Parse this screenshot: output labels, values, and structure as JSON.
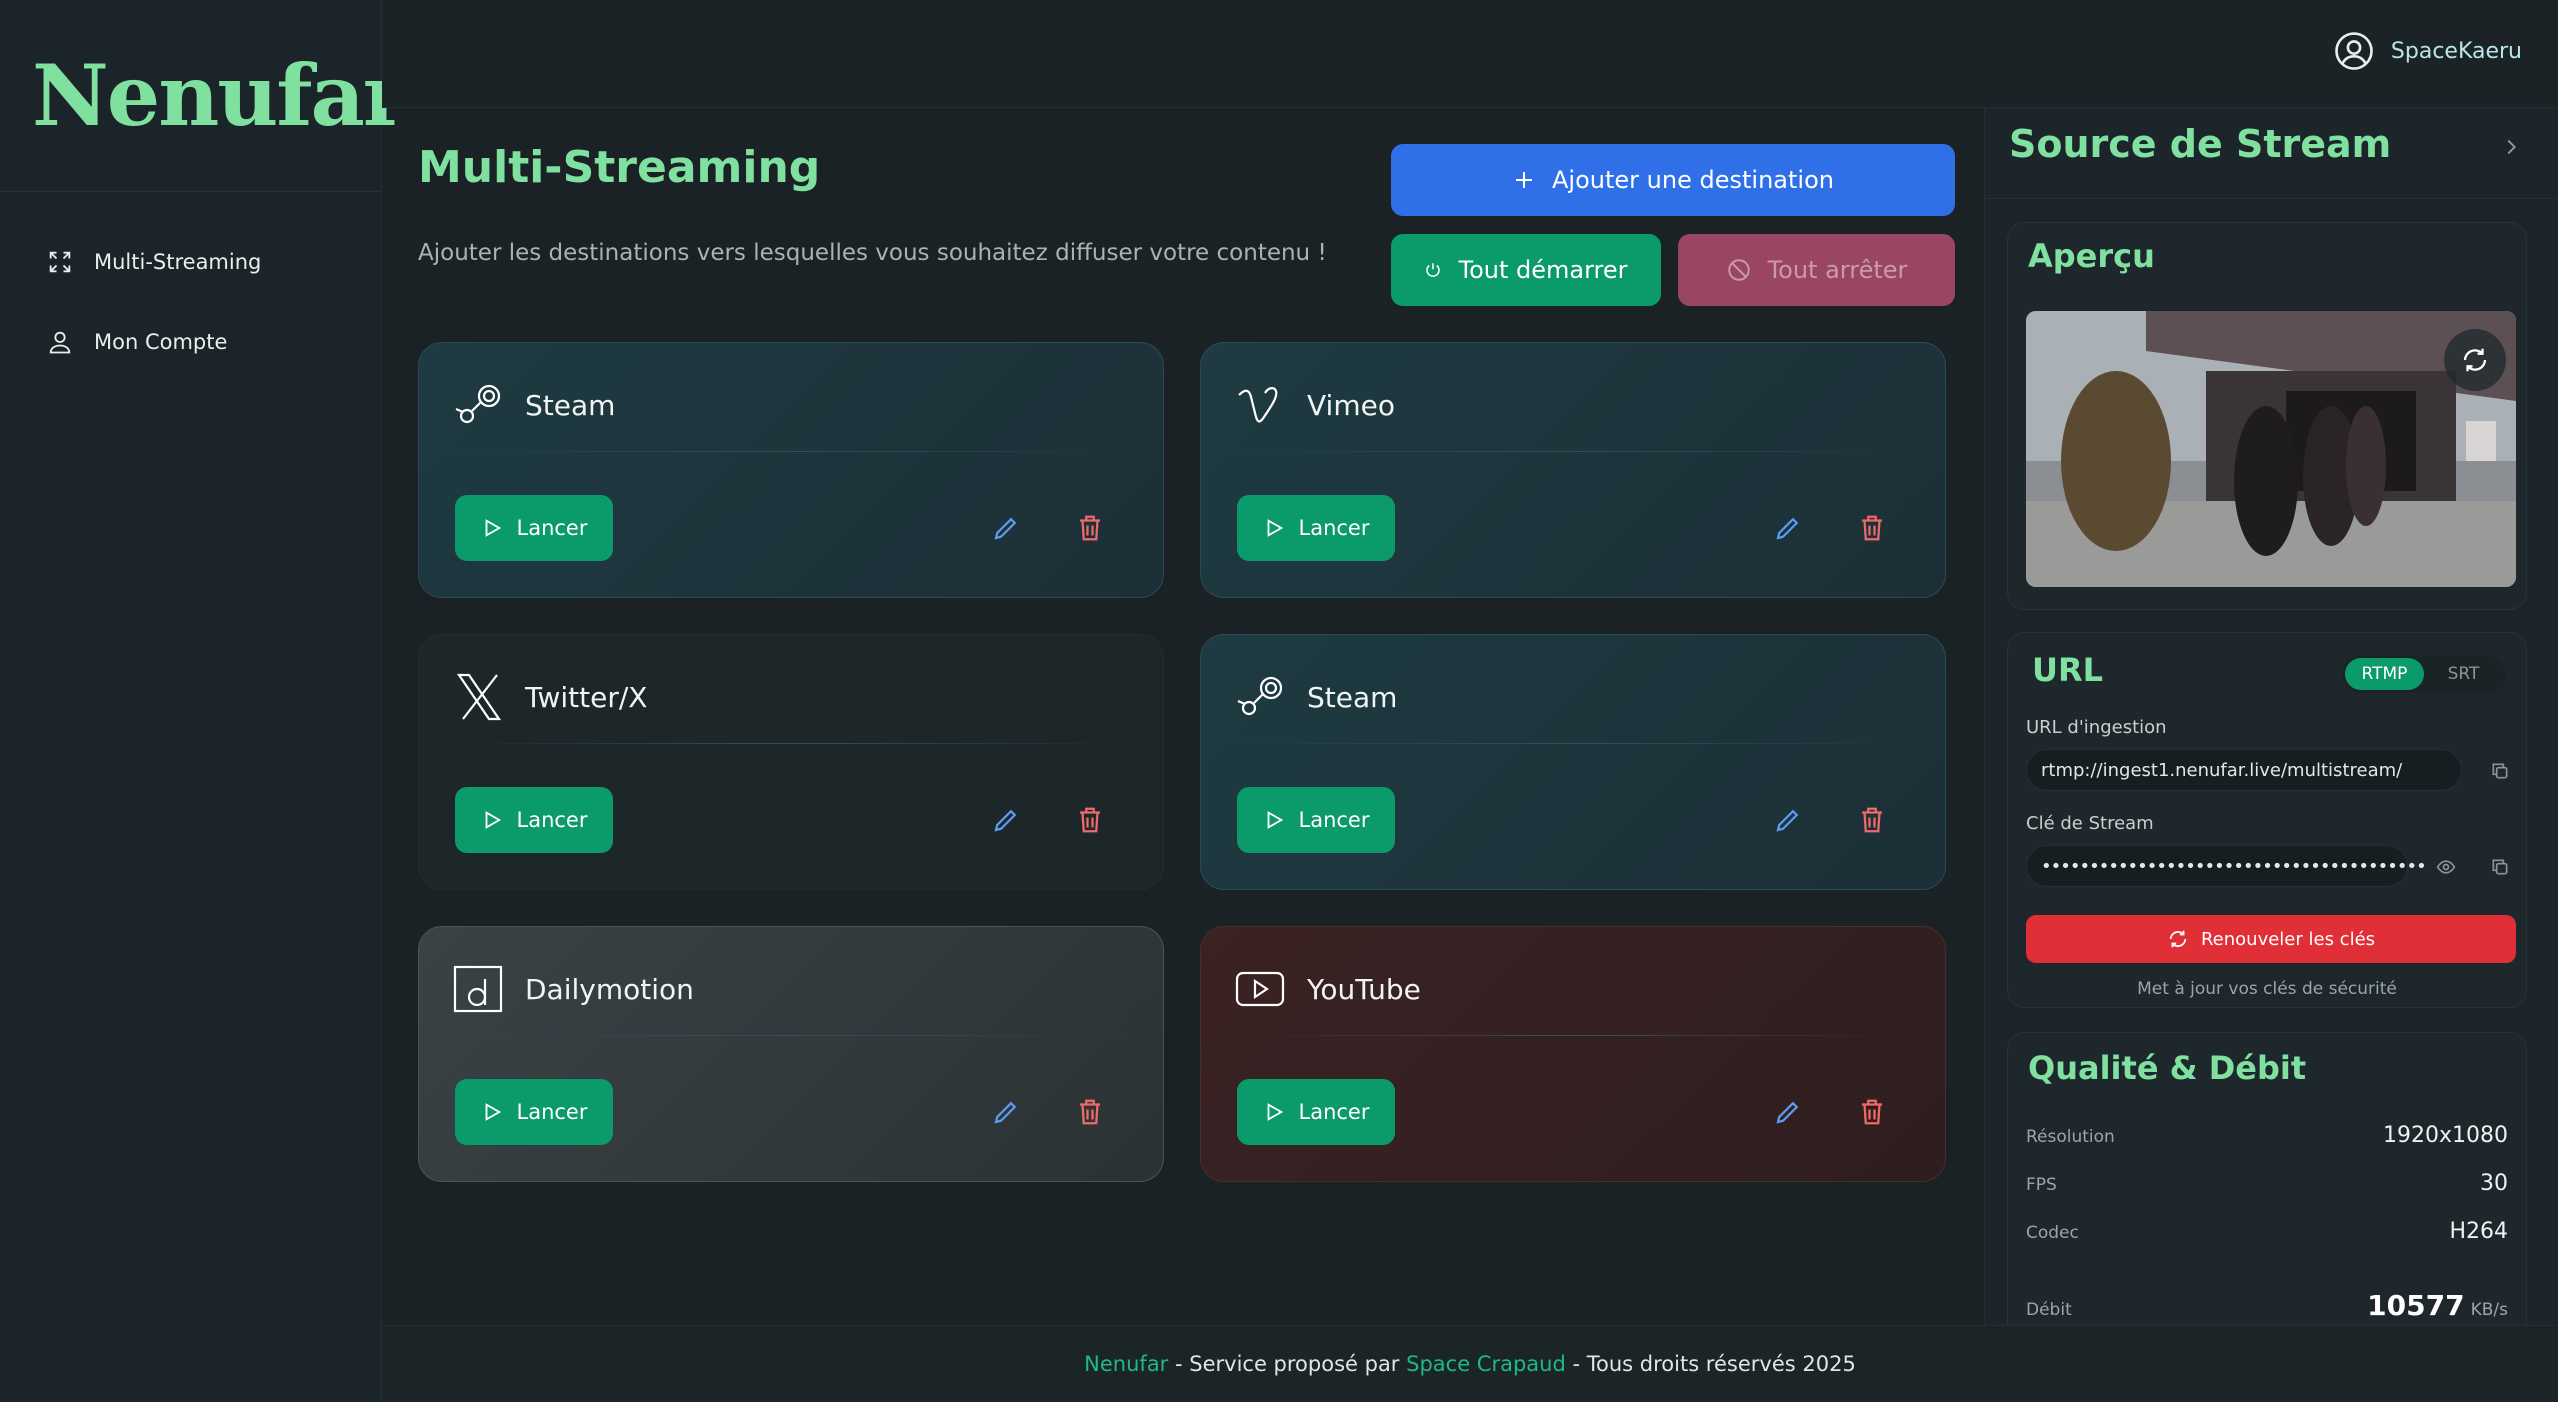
{
  "app": {
    "logo": "Nenufar"
  },
  "sidebar": {
    "items": [
      {
        "label": "Multi-Streaming",
        "icon": "expand-icon"
      },
      {
        "label": "Mon Compte",
        "icon": "user-icon"
      }
    ]
  },
  "header": {
    "username": "SpaceKaeru"
  },
  "main": {
    "title": "Multi-Streaming",
    "subtitle": "Ajouter les destinations vers lesquelles vous souhaitez diffuser votre contenu !",
    "add_label": "Ajouter une destination",
    "start_all_label": "Tout démarrer",
    "stop_all_label": "Tout arrêter",
    "launch_label": "Lancer",
    "destinations": [
      {
        "name": "Steam",
        "icon": "steam-icon"
      },
      {
        "name": "Vimeo",
        "icon": "vimeo-icon"
      },
      {
        "name": "Twitter/X",
        "icon": "x-icon"
      },
      {
        "name": "Steam",
        "icon": "steam-icon"
      },
      {
        "name": "Dailymotion",
        "icon": "dailymotion-icon"
      },
      {
        "name": "YouTube",
        "icon": "youtube-icon"
      }
    ]
  },
  "panel": {
    "title": "Source de Stream",
    "preview_title": "Aperçu",
    "url_title": "URL",
    "protocols": [
      "RTMP",
      "SRT"
    ],
    "ingest_label": "URL d'ingestion",
    "ingest_value": "rtmp://ingest1.nenufar.live/multistream/",
    "key_label": "Clé de Stream",
    "key_value": "••••••••••••••••••••••••••••••••••••••••",
    "renew_label": "Renouveler les clés",
    "renew_hint": "Met à jour vos clés de sécurité",
    "quality_title": "Qualité & Débit",
    "quality": [
      {
        "k": "Résolution",
        "v": "1920x1080"
      },
      {
        "k": "FPS",
        "v": "30"
      },
      {
        "k": "Codec",
        "v": "H264"
      }
    ],
    "bitrate_label": "Débit",
    "bitrate_value": "10577",
    "bitrate_unit": "KB/s"
  },
  "footer": {
    "brand": "Nenufar",
    "mid": " - Service proposé par ",
    "company": "Space Crapaud",
    "tail": " - Tous droits réservés 2025"
  },
  "colors": {
    "accent": "#7fe0a0",
    "primary": "#2f6fe8",
    "success": "#0b9a6a",
    "danger": "#e02f36"
  }
}
